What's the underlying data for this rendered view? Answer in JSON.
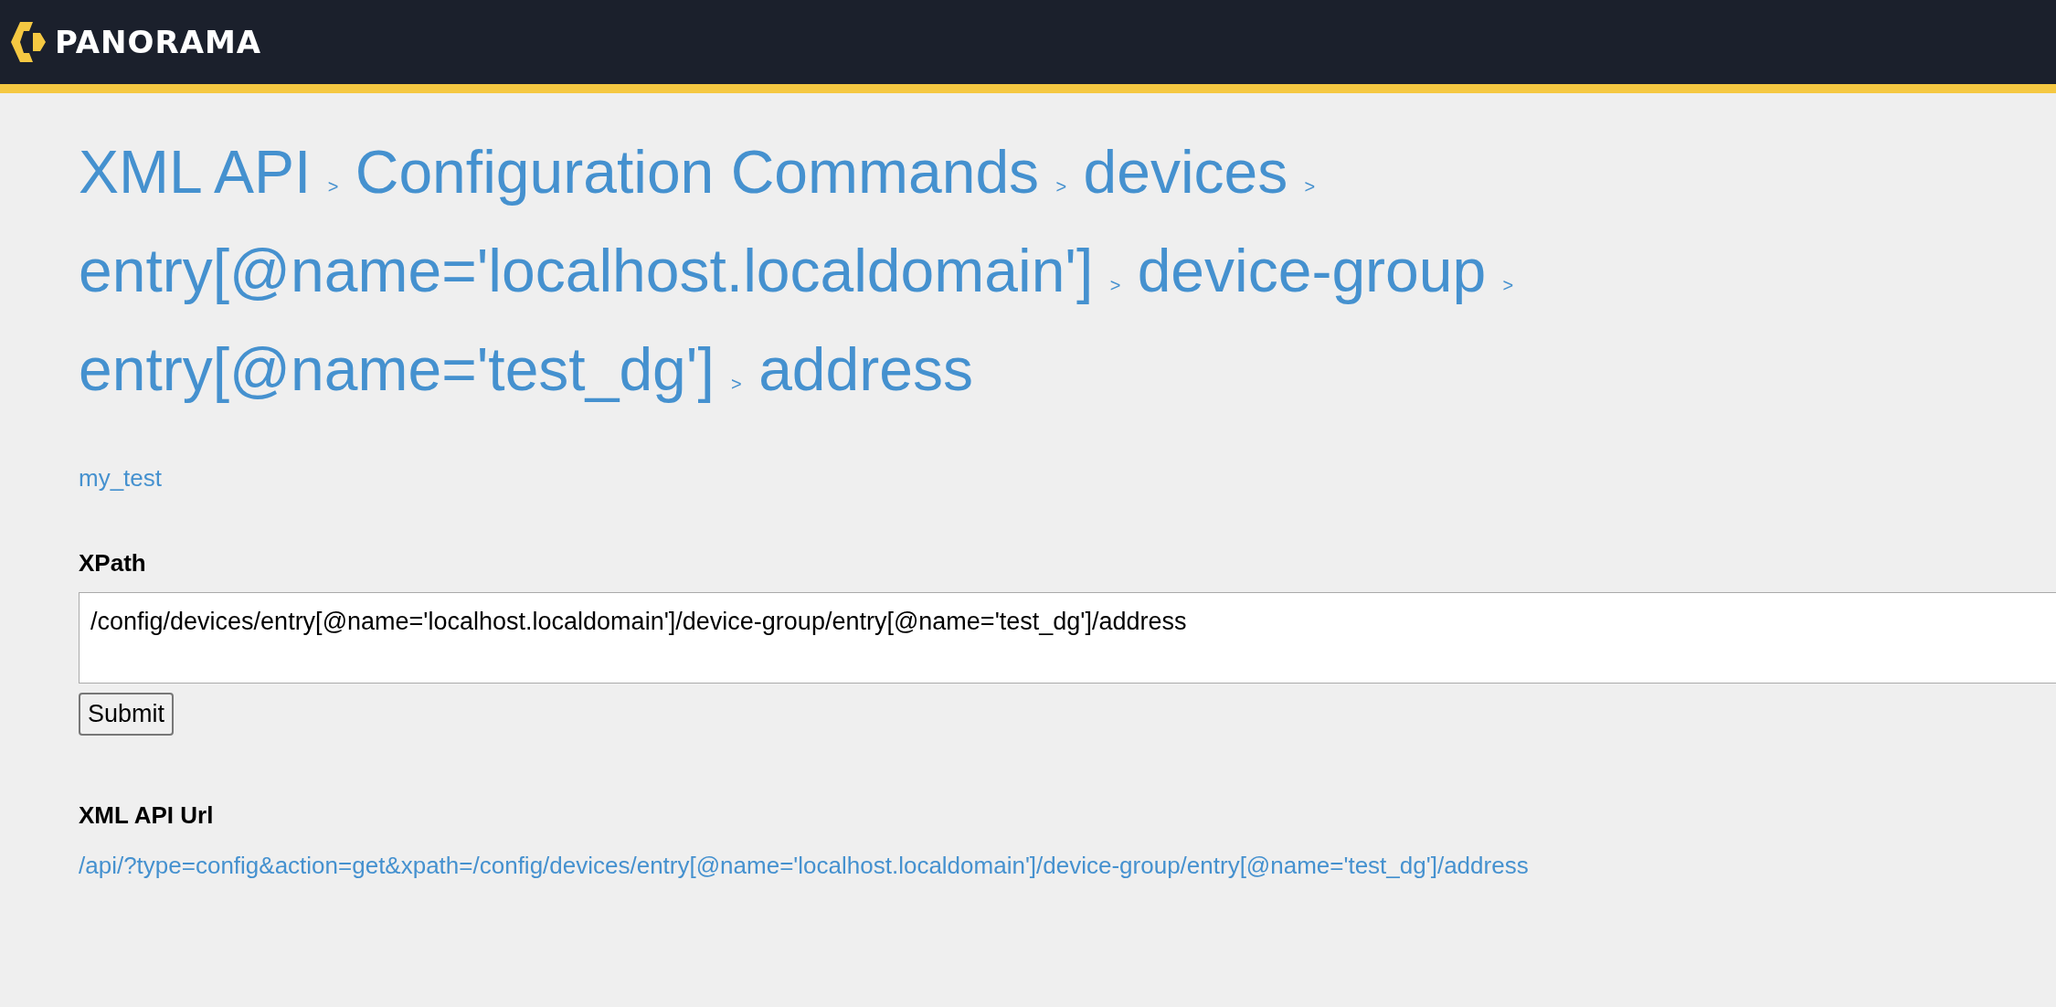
{
  "header": {
    "brand": "PANORAMA"
  },
  "breadcrumb": {
    "separator": ">",
    "items": [
      {
        "label": "XML API"
      },
      {
        "label": "Configuration Commands"
      },
      {
        "label": "devices"
      },
      {
        "label": "entry[@name='localhost.localdomain']"
      },
      {
        "label": "device-group"
      },
      {
        "label": "entry[@name='test_dg']"
      },
      {
        "label": "address"
      }
    ]
  },
  "link": "my_test",
  "xpath": {
    "label": "XPath",
    "value": "/config/devices/entry[@name='localhost.localdomain']/device-group/entry[@name='test_dg']/address"
  },
  "submit": "Submit",
  "api_url": {
    "label": "XML API Url",
    "value": "/api/?type=config&action=get&xpath=/config/devices/entry[@name='localhost.localdomain']/device-group/entry[@name='test_dg']/address"
  }
}
